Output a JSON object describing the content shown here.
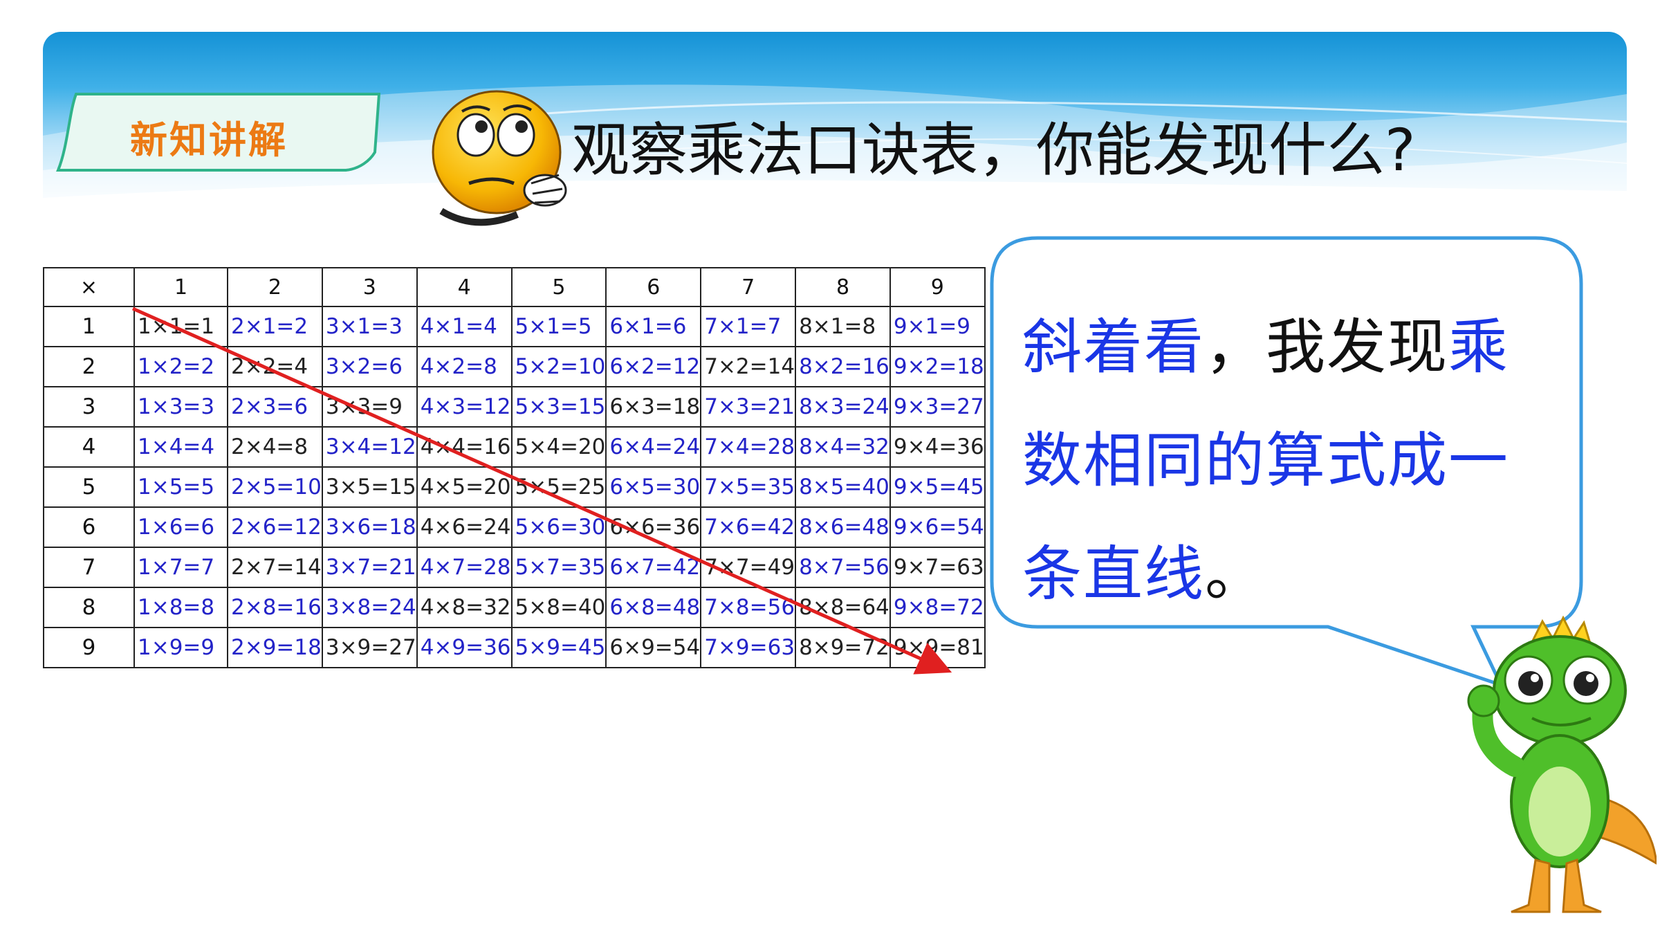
{
  "header": {
    "tag_label": "新知讲解",
    "title": "观察乘法口诀表，你能发现什么?"
  },
  "table": {
    "corner": "×",
    "col_headers": [
      "1",
      "2",
      "3",
      "4",
      "5",
      "6",
      "7",
      "8",
      "9"
    ],
    "row_headers": [
      "1",
      "2",
      "3",
      "4",
      "5",
      "6",
      "7",
      "8",
      "9"
    ],
    "rows": [
      [
        "1×1=1",
        "2×1=2",
        "3×1=3",
        "4×1=4",
        "5×1=5",
        "6×1=6",
        "7×1=7",
        "8×1=8",
        "9×1=9"
      ],
      [
        "1×2=2",
        "2×2=4",
        "3×2=6",
        "4×2=8",
        "5×2=10",
        "6×2=12",
        "7×2=14",
        "8×2=16",
        "9×2=18"
      ],
      [
        "1×3=3",
        "2×3=6",
        "3×3=9",
        "4×3=12",
        "5×3=15",
        "6×3=18",
        "7×3=21",
        "8×3=24",
        "9×3=27"
      ],
      [
        "1×4=4",
        "2×4=8",
        "3×4=12",
        "4×4=16",
        "5×4=20",
        "6×4=24",
        "7×4=28",
        "8×4=32",
        "9×4=36"
      ],
      [
        "1×5=5",
        "2×5=10",
        "3×5=15",
        "4×5=20",
        "5×5=25",
        "6×5=30",
        "7×5=35",
        "8×5=40",
        "9×5=45"
      ],
      [
        "1×6=6",
        "2×6=12",
        "3×6=18",
        "4×6=24",
        "5×6=30",
        "6×6=36",
        "7×6=42",
        "8×6=48",
        "9×6=54"
      ],
      [
        "1×7=7",
        "2×7=14",
        "3×7=21",
        "4×7=28",
        "5×7=35",
        "6×7=42",
        "7×7=49",
        "8×7=56",
        "9×7=63"
      ],
      [
        "1×8=8",
        "2×8=16",
        "3×8=24",
        "4×8=32",
        "5×8=40",
        "6×8=48",
        "7×8=56",
        "8×8=64",
        "9×8=72"
      ],
      [
        "1×9=9",
        "2×9=18",
        "3×9=27",
        "4×9=36",
        "5×9=45",
        "6×9=54",
        "7×9=63",
        "8×9=72",
        "9×9=81"
      ]
    ],
    "black_cells": [
      "1-1",
      "2-2",
      "3-3",
      "4-4",
      "5-5",
      "6-6",
      "7-7",
      "8-8",
      "9-9",
      "8-1",
      "7-2",
      "6-3",
      "5-4",
      "4-5",
      "3-5",
      "4-6",
      "2-4",
      "2-7",
      "5-8",
      "3-9",
      "6-9",
      "9-4",
      "9-7",
      "8-9",
      "4-8"
    ]
  },
  "bubble": {
    "part1": "斜着看",
    "part2": "，我发现",
    "part3": "乘数相同的算式成一条直线",
    "part4": "。"
  },
  "colors": {
    "blue_text": "#2323c8",
    "orange_tag": "#ec7a14",
    "red_line": "#e02020",
    "bubble_border": "#3b9be0"
  }
}
